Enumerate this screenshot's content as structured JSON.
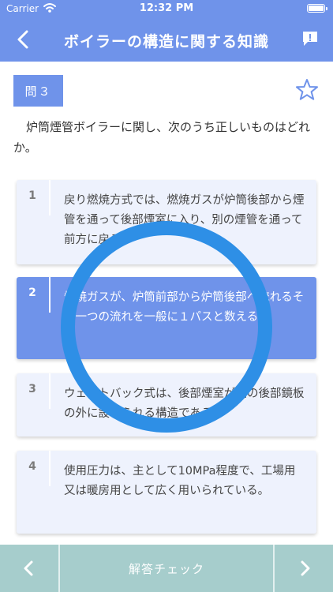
{
  "status": {
    "carrier": "Carrier",
    "time": "12:32 PM"
  },
  "nav": {
    "title": "ボイラーの構造に関する知識",
    "back_icon": "chevron-left-icon",
    "report_icon": "report-bubble-icon"
  },
  "question": {
    "badge": "問３",
    "text": "炉筒煙管ボイラーに関し、次のうち正しいものはどれか。"
  },
  "options": [
    {
      "num": "1",
      "text": "戻り燃焼方式では、燃焼ガスが炉筒後部から煙管を通って後部煙室に入り、別の煙管を通って前方に戻る。",
      "selected": false
    },
    {
      "num": "2",
      "text": "燃焼ガスが、炉筒前部から炉筒後部へ流れるその一つの流れを一般に１パスと数える。",
      "selected": true
    },
    {
      "num": "3",
      "text": "ウェットバック式は、後部煙室が胴の後部鏡板の外に設けられる構造である。",
      "selected": false
    },
    {
      "num": "4",
      "text": "使用圧力は、主として10MPa程度で、工場用又は暖房用として広く用いられている。",
      "selected": false
    }
  ],
  "bottom": {
    "check_label": "解答チェック"
  },
  "colors": {
    "accent": "#6f93ea",
    "option_bg": "#eef2fd",
    "ring": "#2e8fe6",
    "bottom_bar": "#a6cdcc"
  }
}
